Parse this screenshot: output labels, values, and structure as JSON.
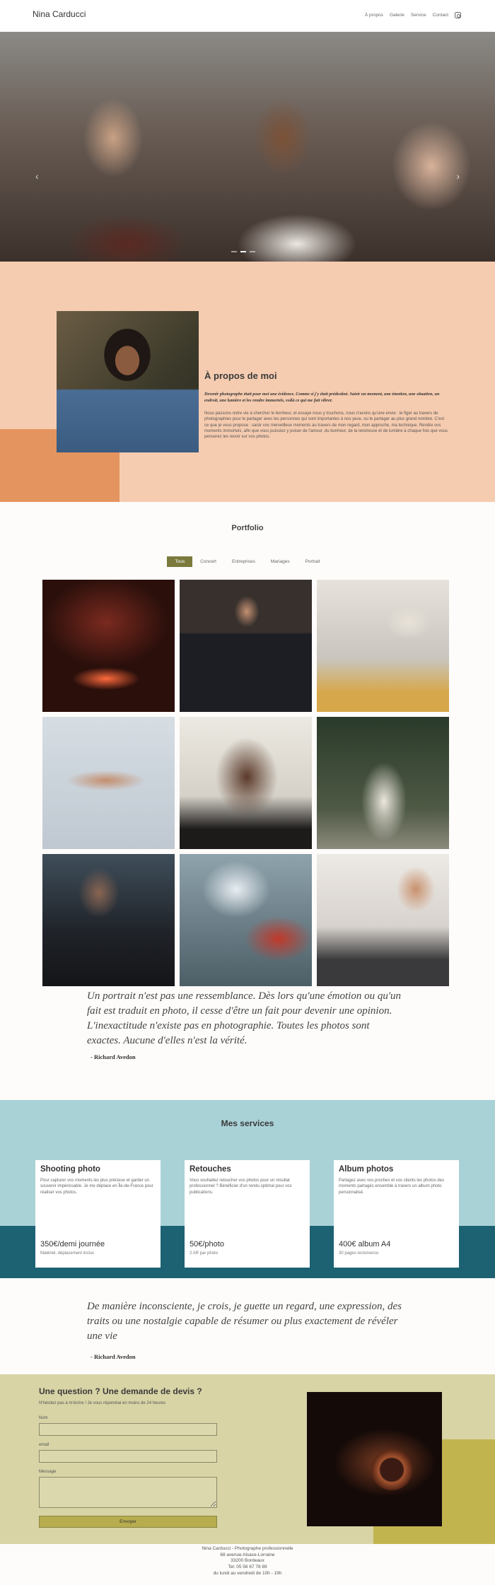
{
  "header": {
    "brand": "Nina Carducci",
    "nav": [
      "À propos",
      "Galerie",
      "Service",
      "Contact"
    ],
    "social_icon": "instagram-icon"
  },
  "hero": {
    "prev_icon": "chevron-left-icon",
    "next_icon": "chevron-right-icon",
    "prev_glyph": "‹",
    "next_glyph": "›",
    "slide_count": 3,
    "active_slide": 2
  },
  "about": {
    "title": "À propos de moi",
    "lead": "Devenir photographe était pour moi une évidence. Comme si j'y était prédestiné. Saisir un moment, une émotion, une situation, un endroit, une lumière et les rendre immortels, voilà ce qui me fait vibrer.",
    "text": "Nous passons notre vie à chercher le bonheur, et essaye nous y touchons, nous n'avons qu'une envie : le figer au travers de photographies pour le partager avec les personnes qui sont importantes à nos yeux, ou le partager au plus grand nombre. C'est ce que je vous propose : saisir vos merveilleux moments au travers de mon regard, mon approche, ma technique. Rendre vos moments immortels, afin que vous puissiez y puiser de l'amour, du bonheur, de la tendresse et de lumière à chaque fois que vous penserez les revoir sur vos photos."
  },
  "portfolio": {
    "title": "Portfolio",
    "filters": [
      "Tous",
      "Concert",
      "Entreprises",
      "Mariages",
      "Portrait"
    ],
    "active_filter": "Tous"
  },
  "quotes": [
    {
      "text": "Un portrait n'est pas une ressemblance. Dès lors qu'une émotion ou qu'un fait est traduit en photo, il cesse d'être un fait pour devenir une opinion. L'inexactitude n'existe pas en photographie. Toutes les photos sont exactes. Aucune d'elles n'est la vérité.",
      "author": "- Richard Avedon"
    },
    {
      "text": "De manière inconsciente, je crois, je guette un regard, une expression, des traits ou une nostalgie capable de résumer ou plus exactement de révéler une vie",
      "author": "- Richard Avedon"
    }
  ],
  "services": {
    "title": "Mes services",
    "items": [
      {
        "name": "Shooting photo",
        "description": "Pour capturer vos moments les plus précieux et garder un souvenir impérissable. Je me déplace en Île-de-France pour réaliser vos photos.",
        "price": "350€/demi journée",
        "note": "Matériel, déplacement inclus"
      },
      {
        "name": "Retouches",
        "description": "Vous souhaitez retoucher vos photos pour un résultat professionnel ? Bénéficier d'un rendu optimal pour vos publications.",
        "price": "50€/photo",
        "note": "2 AR par photo"
      },
      {
        "name": "Album photos",
        "description": "Partagez avec vos proches et vos clients les photos des moments partagés ensemble à travers un album photo personnalisé.",
        "price": "400€ album A4",
        "note": "30 pages recto/verso"
      }
    ]
  },
  "contact": {
    "title": "Une question ? Une demande de devis ?",
    "subtitle": "N'hésitez pas à m'écrire ! Je vous répondrai en moins de 24 heures",
    "fields": {
      "name_label": "Nom",
      "email_label": "email",
      "message_label": "Message"
    },
    "submit": "Envoyer"
  },
  "footer": {
    "lines": [
      "Nina Carducci - Photographe professionnelle",
      "68 avenue Alsace-Lorraine",
      "33200 Bordeaux",
      "Tel: 05 56 67 78 89",
      "du lundi au vendredi de 10h - 19h"
    ]
  }
}
